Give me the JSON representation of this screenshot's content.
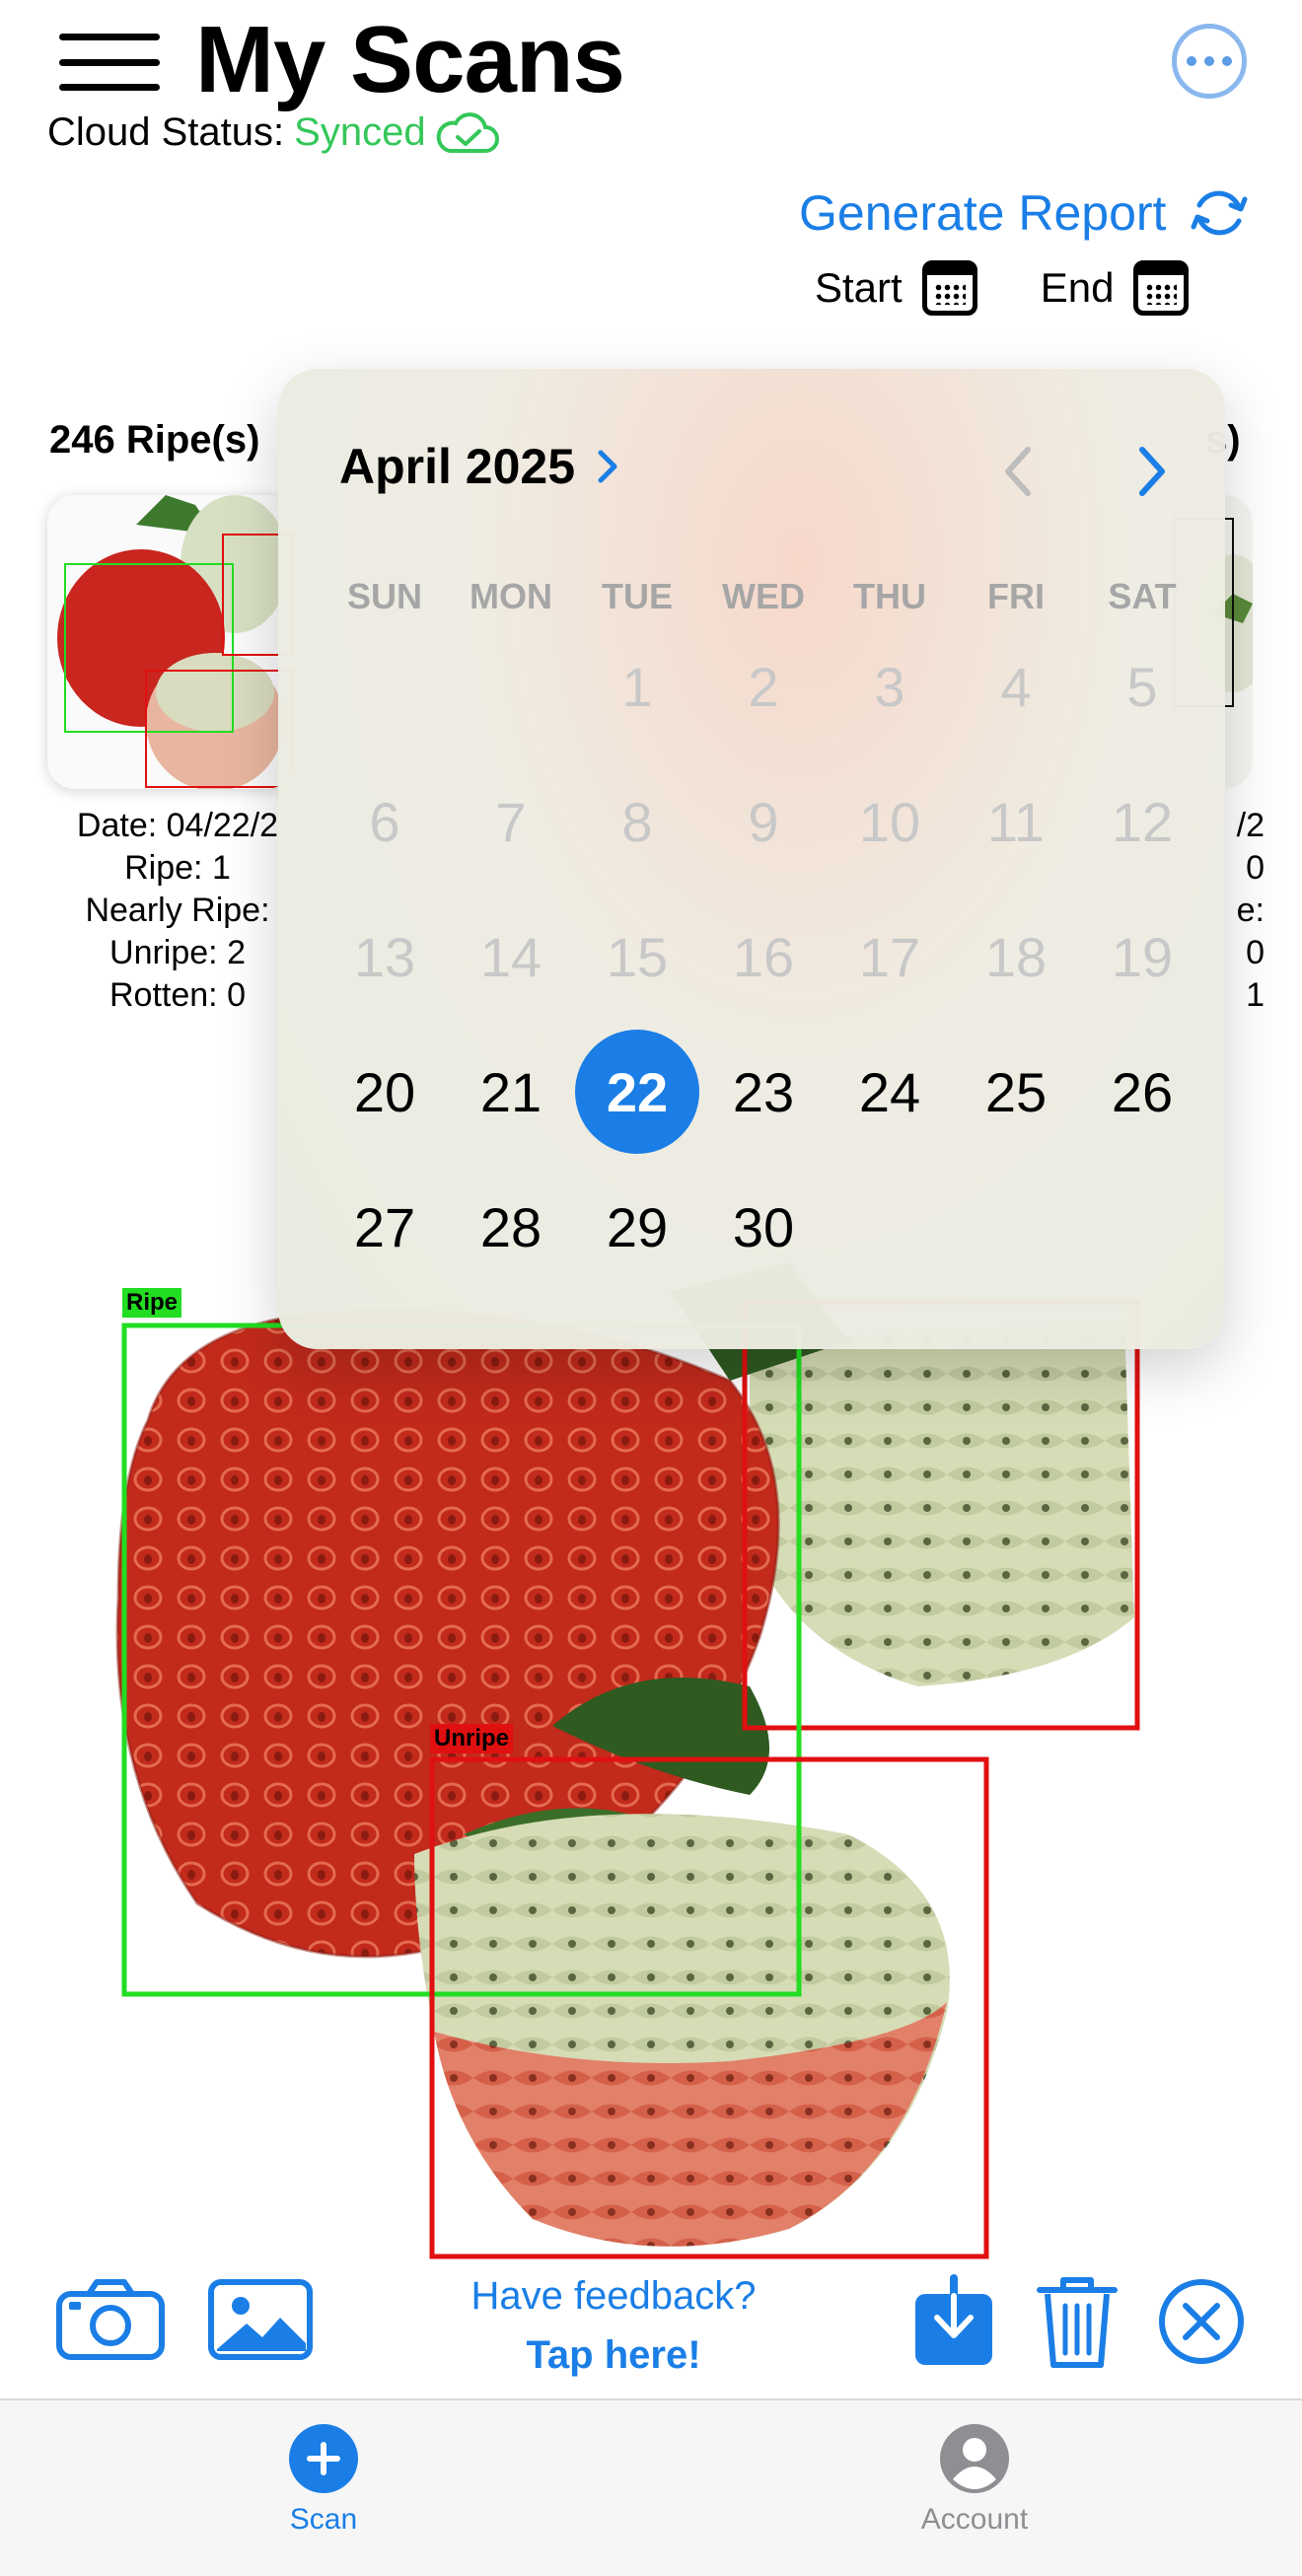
{
  "header": {
    "title": "My Scans",
    "cloud_label": "Cloud Status:",
    "cloud_status": "Synced",
    "more_icon": "ellipsis-circle-icon"
  },
  "report": {
    "generate_label": "Generate Report",
    "start_label": "Start",
    "end_label": "End"
  },
  "scans": {
    "left": {
      "count_label": "246 Ripe(s)",
      "date": "Date: 04/22/2",
      "ripe": "Ripe: 1",
      "nearly_ripe": "Nearly Ripe:",
      "unripe": "Unripe: 2",
      "rotten": "Rotten: 0"
    },
    "right": {
      "count_label": "s)",
      "date": "/2",
      "ripe": "0",
      "nearly_ripe": "e:",
      "unripe": "0",
      "rotten": "1"
    }
  },
  "detection": {
    "labels": [
      "Ripe",
      "Unripe"
    ],
    "colors": {
      "ripe": "#22dd22",
      "unripe": "#e01010"
    }
  },
  "calendar": {
    "month_label": "April 2025",
    "weekdays": [
      "SUN",
      "MON",
      "TUE",
      "WED",
      "THU",
      "FRI",
      "SAT"
    ],
    "days": [
      "1",
      "2",
      "3",
      "4",
      "5",
      "6",
      "7",
      "8",
      "9",
      "10",
      "11",
      "12",
      "13",
      "14",
      "15",
      "16",
      "17",
      "18",
      "19",
      "20",
      "21",
      "22",
      "23",
      "24",
      "25",
      "26",
      "27",
      "28",
      "29",
      "30"
    ],
    "first_weekday_index": 2,
    "selected_day": "22",
    "disabled_through": 19,
    "accent": "#1a7ee6"
  },
  "toolbar": {
    "feedback_line1": "Have feedback?",
    "feedback_line2": "Tap here!",
    "icons": [
      "camera-icon",
      "photo-library-icon",
      "download-icon",
      "trash-icon",
      "close-circle-icon"
    ]
  },
  "tabs": [
    {
      "label": "Scan",
      "icon": "plus-circle-icon",
      "active": true
    },
    {
      "label": "Account",
      "icon": "person-circle-icon",
      "active": false
    }
  ]
}
